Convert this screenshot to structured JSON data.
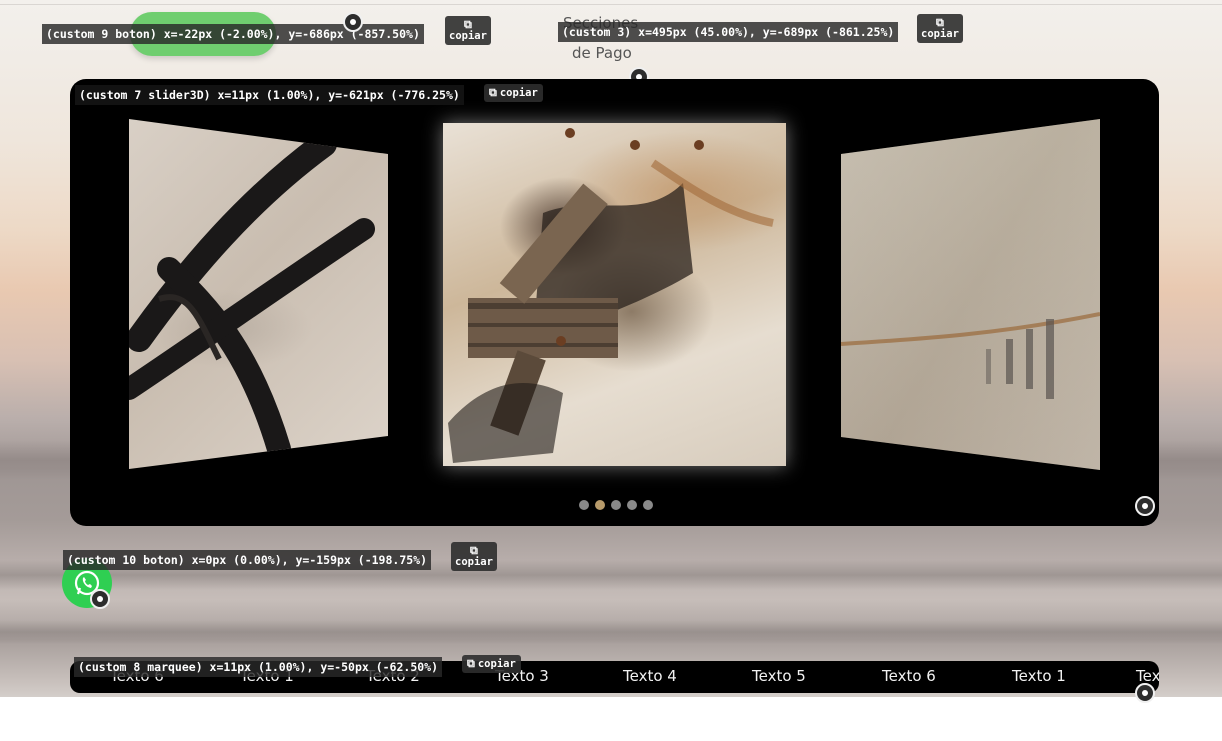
{
  "labels": {
    "custom9": "(custom 9 boton) x=-22px (-2.00%), y=-686px (-857.50%)",
    "custom3": "(custom 3) x=495px (45.00%), y=-689px (-861.25%)",
    "custom7": "(custom 7 slider3D) x=11px (1.00%), y=-621px (-776.25%)",
    "custom10": "(custom 10 boton) x=0px (0.00%), y=-159px (-198.75%)",
    "custom8": "(custom 8 marquee) x=11px (1.00%), y=-50px (-62.50%)"
  },
  "copy_label": "copiar",
  "nav": {
    "secciones": "Secciones",
    "de_pago": "de Pago"
  },
  "slider": {
    "slide_count": 5,
    "active_index": 1
  },
  "marquee": {
    "items": [
      "Texto 6",
      "Texto 1",
      "Texto 2",
      "Texto 3",
      "Texto 4",
      "Texto 5",
      "Texto 6",
      "Texto 1",
      "Tex"
    ]
  },
  "colors": {
    "green_button": "#6fce6f",
    "whatsapp": "#2fcf52",
    "active_dot": "#b79a6a"
  }
}
